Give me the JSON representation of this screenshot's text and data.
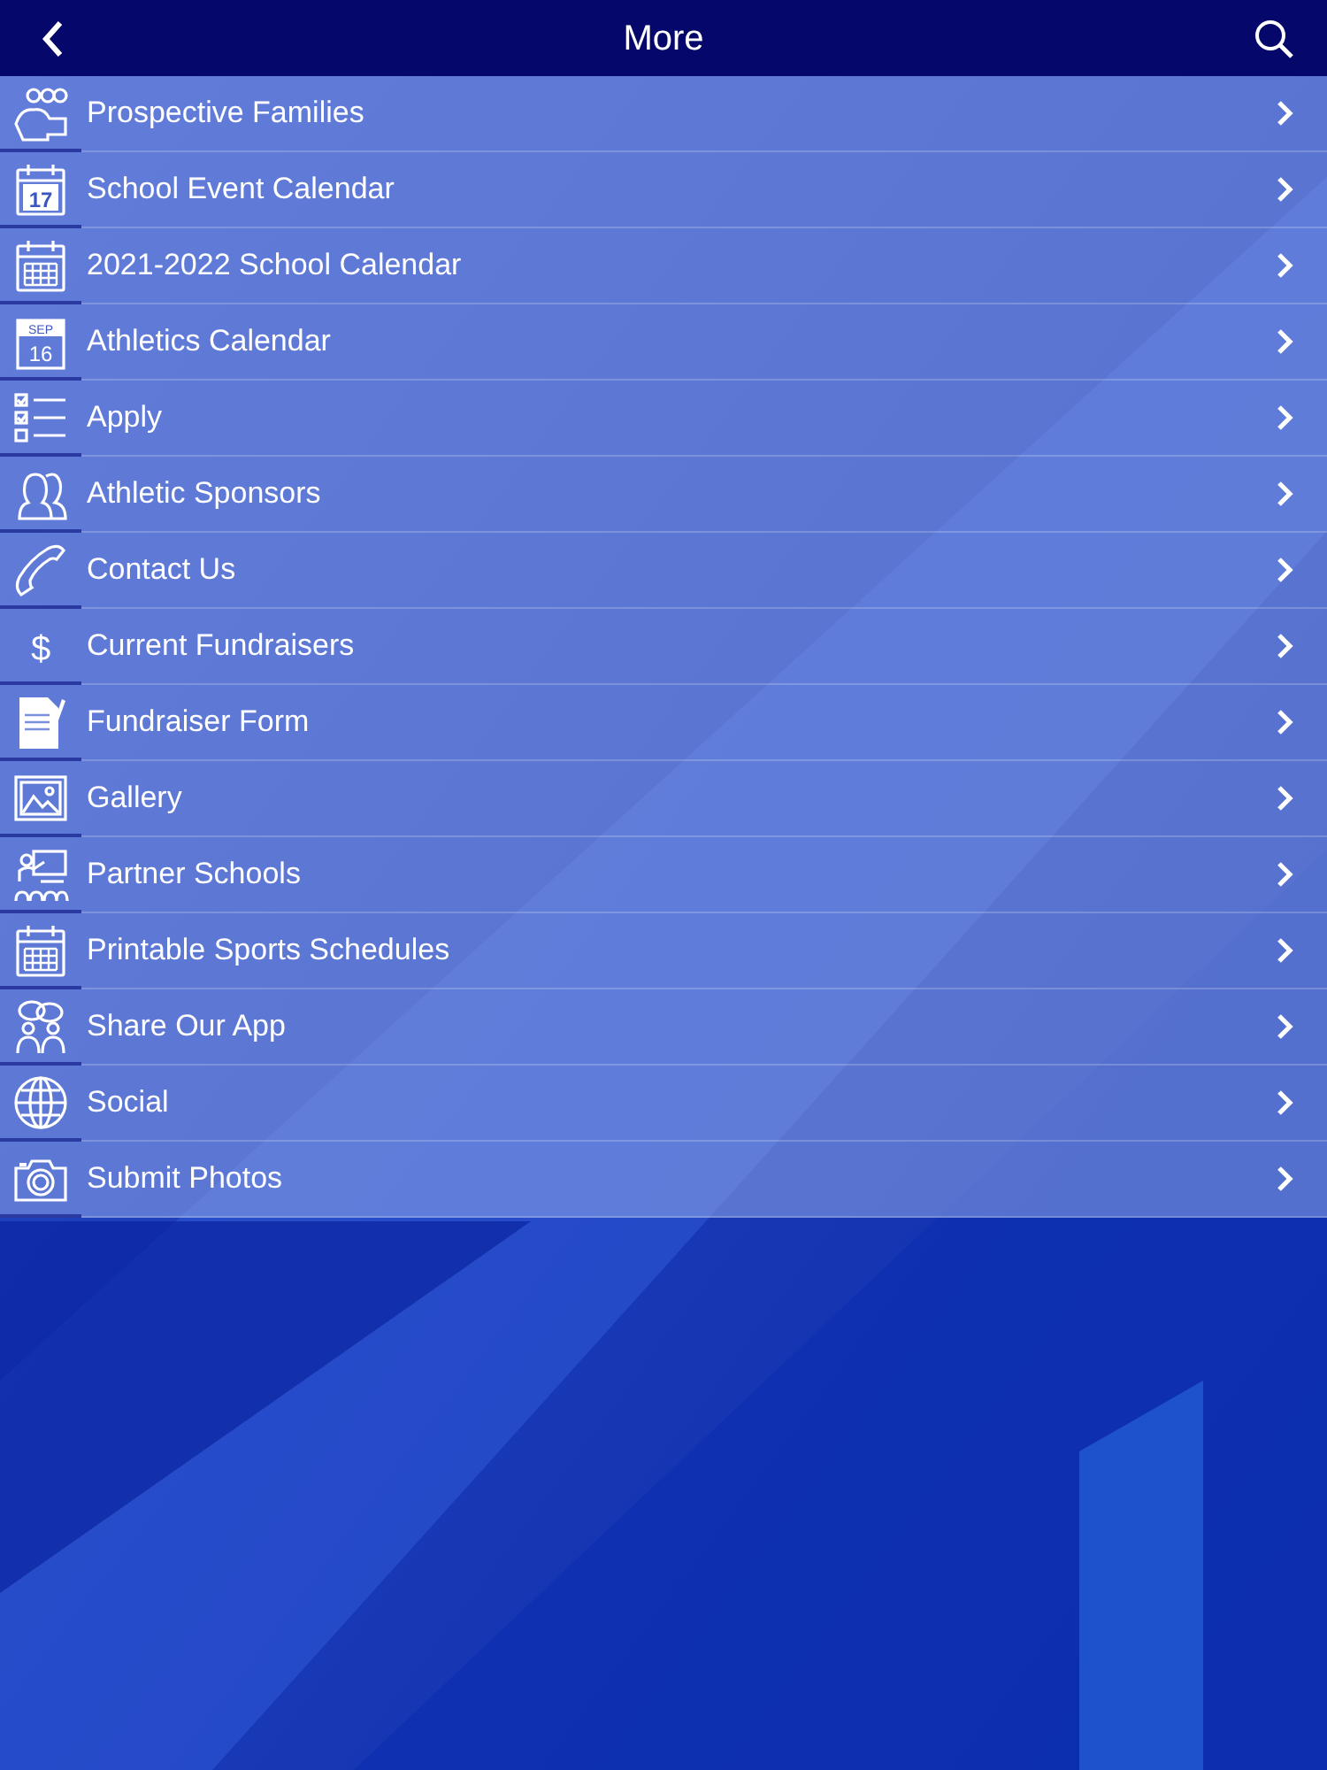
{
  "header": {
    "title": "More"
  },
  "items": [
    {
      "label": "Prospective Families",
      "kind": "people"
    },
    {
      "label": "School Event Calendar",
      "kind": "calendar-day",
      "icon_text": [
        "17"
      ]
    },
    {
      "label": "2021-2022 School Calendar",
      "kind": "calendar-grid"
    },
    {
      "label": "Athletics Calendar",
      "kind": "calendar-month",
      "icon_text": [
        "SEP",
        "16"
      ]
    },
    {
      "label": "Apply",
      "kind": "checklist"
    },
    {
      "label": "Athletic Sponsors",
      "kind": "persons"
    },
    {
      "label": "Contact Us",
      "kind": "phone"
    },
    {
      "label": "Current Fundraisers",
      "kind": "glyph",
      "icon_text": [
        "$"
      ]
    },
    {
      "label": "Fundraiser Form",
      "kind": "form"
    },
    {
      "label": "Gallery",
      "kind": "image"
    },
    {
      "label": "Partner Schools",
      "kind": "teacher"
    },
    {
      "label": "Printable Sports Schedules",
      "kind": "calendar-grid"
    },
    {
      "label": "Share Our App",
      "kind": "share"
    },
    {
      "label": "Social",
      "kind": "globe"
    },
    {
      "label": "Submit Photos",
      "kind": "camera"
    }
  ]
}
